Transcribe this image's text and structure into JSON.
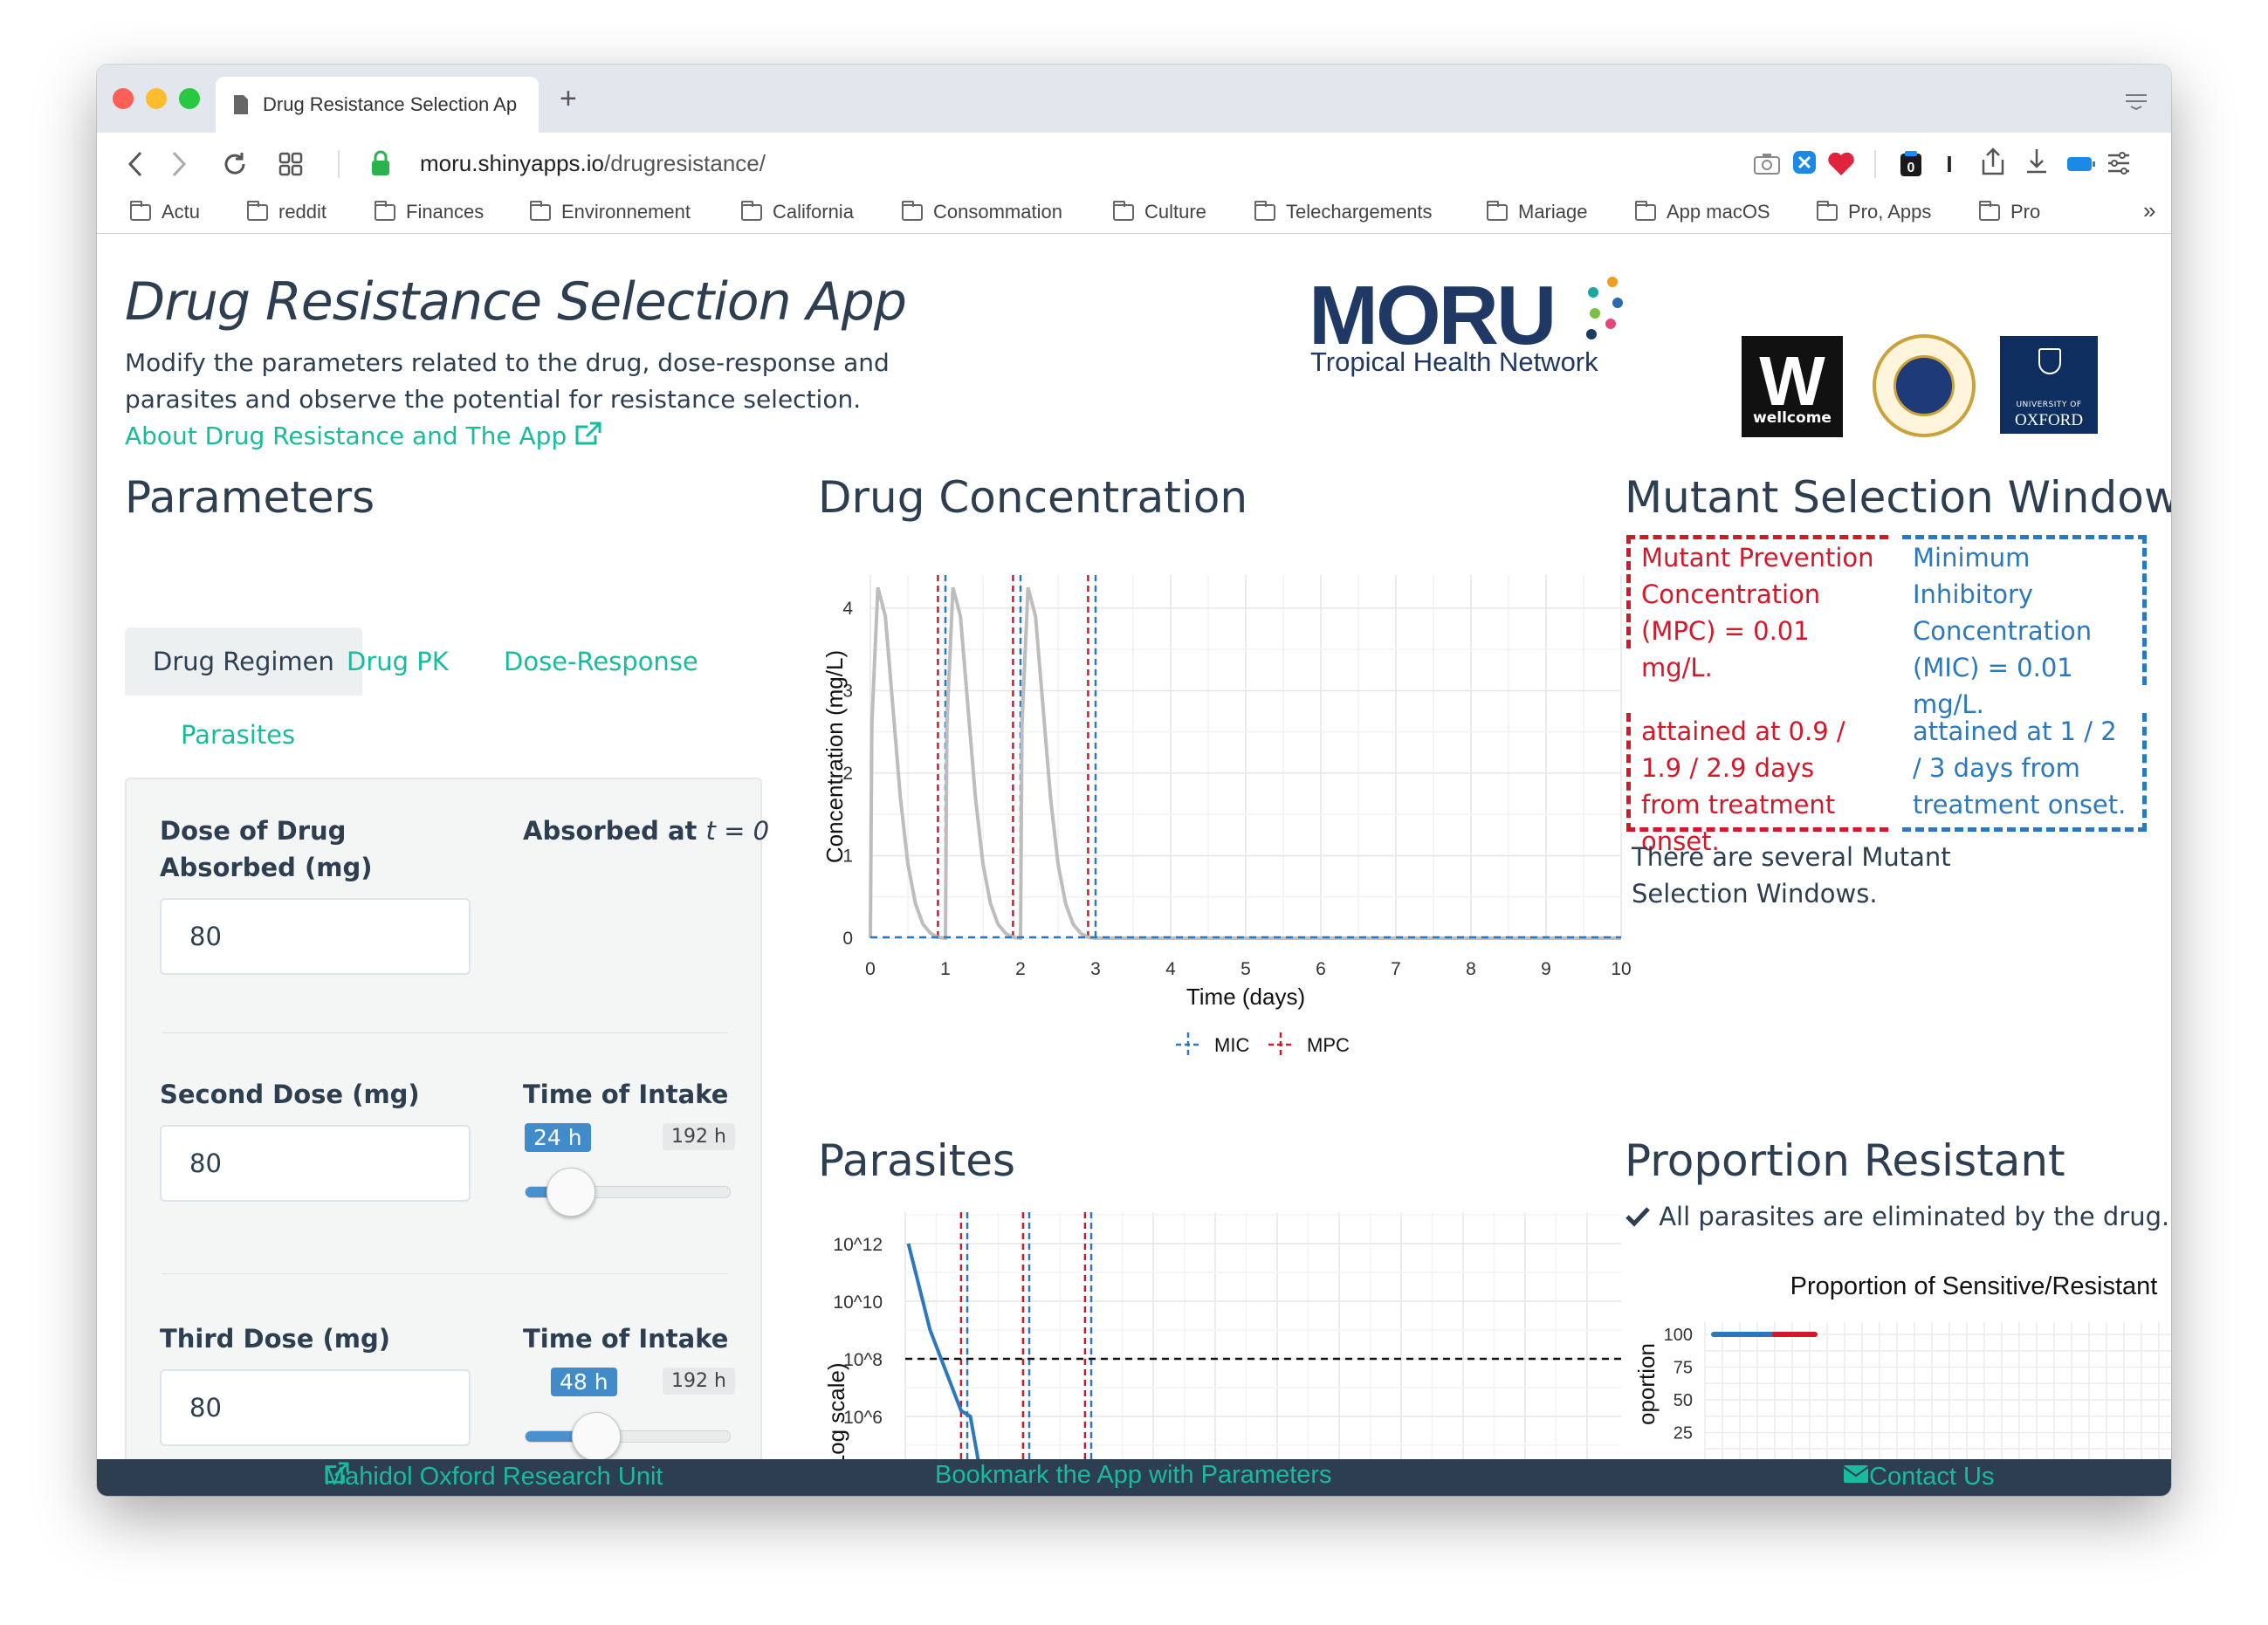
{
  "browser": {
    "tab_title": "Drug Resistance Selection Ap",
    "url_host": "moru.shinyapps.io",
    "url_path": "/drugresistance/",
    "bookmarks": [
      "Actu",
      "reddit",
      "Finances",
      "Environnement",
      "California",
      "Consommation",
      "Culture",
      "Telechargements",
      "Mariage",
      "App macOS",
      "Pro, Apps",
      "Pro"
    ],
    "more_bookmarks": "»",
    "icons": [
      "back-icon",
      "forward-icon",
      "reload-icon",
      "tab-grid-icon",
      "lock-icon",
      "camera-icon",
      "heart-icon",
      "share-icon",
      "download-icon",
      "battery-icon",
      "settings-icon"
    ]
  },
  "header": {
    "title": "Drug Resistance Selection App",
    "intro": "Modify the parameters related to the drug, dose-response and parasites and observe the potential for resistance selection.",
    "about_link": "About Drug Resistance and The App",
    "logos": {
      "moru_word": "MORU",
      "moru_sub": "Tropical Health Network",
      "wellcome_letter": "W",
      "wellcome": "wellcome",
      "oxford_university": "UNIVERSITY OF",
      "oxford": "OXFORD"
    }
  },
  "parameters": {
    "title": "Parameters",
    "tabs": [
      "Drug Regimen",
      "Drug PK",
      "Dose-Response",
      "Parasites"
    ],
    "dose_label": "Dose of Drug Absorbed (mg)",
    "dose_value": "80",
    "absorbed_label": "Absorbed at",
    "absorbed_t": "t = 0",
    "second_dose_label": "Second Dose (mg)",
    "second_dose_value": "80",
    "third_dose_label": "Third Dose (mg)",
    "third_dose_value": "80",
    "intake_label": "Time of Intake",
    "second_intake": {
      "value": "24 h",
      "max": "192 h",
      "fraction": 0.125
    },
    "third_intake": {
      "value": "48 h",
      "max": "192 h",
      "fraction": 0.25
    }
  },
  "drug_concentration": {
    "title": "Drug Concentration",
    "legend": [
      "MIC",
      "MPC"
    ]
  },
  "msw": {
    "title": "Mutant Selection Window",
    "mpc_text": "Mutant Prevention Concentration (MPC) = 0.01 mg/L.",
    "mic_text": "Minimum Inhibitory Concentration (MIC) = 0.01 mg/L.",
    "mpc_attained": "attained at 0.9 / 1.9 / 2.9 days from treatment onset.",
    "mic_attained": "attained at 1 / 2 / 3 days from treatment onset.",
    "note": "There are several Mutant Selection Windows."
  },
  "parasites": {
    "title": "Parasites"
  },
  "proportion": {
    "title": "Proportion Resistant",
    "message": "All parasites are eliminated by the drug.",
    "check_icon": "check-icon"
  },
  "footer": {
    "left": "Mahidol Oxford Research Unit",
    "center": "Bookmark the App with Parameters",
    "right": "Contact Us"
  },
  "colors": {
    "accent": "#18bc9c",
    "heading": "#2c3e50",
    "mpc_red": "#d3182a",
    "mic_blue": "#2c78be",
    "curve_grey": "#bdbdbd"
  },
  "chart_data": [
    {
      "type": "line",
      "title": "",
      "xlabel": "Time (days)",
      "ylabel": "Concentration (mg/L)",
      "x_ticks": [
        "0",
        "1",
        "2",
        "3",
        "4",
        "5",
        "6",
        "7",
        "8",
        "9",
        "10"
      ],
      "y_ticks": [
        "0",
        "1",
        "2",
        "3",
        "4"
      ],
      "xlim": [
        0,
        10
      ],
      "ylim": [
        0,
        4.4
      ],
      "series": [
        {
          "x": [
            0,
            0.02,
            0.1,
            0.2,
            0.3,
            0.4,
            0.5,
            0.6,
            0.7,
            0.8,
            0.9,
            1.0,
            1.02,
            1.1,
            1.2,
            1.3,
            1.4,
            1.5,
            1.6,
            1.7,
            1.8,
            1.9,
            2.0,
            2.02,
            2.1,
            2.2,
            2.3,
            2.4,
            2.5,
            2.6,
            2.7,
            2.8,
            2.9,
            3.0,
            3.2,
            10
          ],
          "y": [
            0,
            2.6,
            4.25,
            3.9,
            2.8,
            1.7,
            0.9,
            0.42,
            0.17,
            0.06,
            0.01,
            0,
            2.6,
            4.25,
            3.9,
            2.8,
            1.7,
            0.9,
            0.42,
            0.17,
            0.06,
            0.01,
            0,
            2.6,
            4.25,
            3.9,
            2.8,
            1.7,
            0.9,
            0.42,
            0.17,
            0.06,
            0.01,
            0,
            0,
            0
          ]
        }
      ],
      "mic": 0.01,
      "mpc": 0.01,
      "mic_days": [
        1,
        2,
        3
      ],
      "mpc_days": [
        0.9,
        1.9,
        2.9
      ],
      "legend": [
        "MIC",
        "MPC"
      ],
      "grid": true
    },
    {
      "type": "line",
      "title": "",
      "ylabel": "Parasites (Log scale)",
      "ylabel_visible": "es (Log scale)",
      "y_ticks": [
        "10^12",
        "10^10",
        "10^8",
        "10^6"
      ],
      "threshold": "10^8",
      "series": [
        {
          "x": [
            0.05,
            0.4,
            0.9,
            1.05,
            1.2
          ],
          "y_log10": [
            12,
            9,
            6.2,
            6.0,
            4.2
          ]
        }
      ],
      "grid": true
    },
    {
      "type": "line",
      "title": "Proportion of Sensitive/Resistant",
      "ylabel": "Proportion",
      "ylabel_visible": "oportion",
      "y_ticks": [
        "100",
        "75",
        "50",
        "25"
      ],
      "series": [
        {
          "name": "Sensitive",
          "color": "#2c78be",
          "y": [
            100,
            100
          ]
        },
        {
          "name": "Resistant",
          "color": "#d3182a",
          "y": [
            100,
            100
          ]
        }
      ],
      "grid": true
    }
  ]
}
